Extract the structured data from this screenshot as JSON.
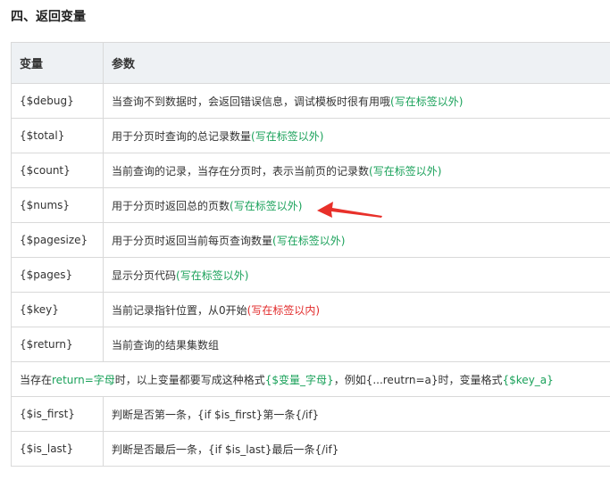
{
  "section_title": "四、返回变量",
  "table": {
    "headers": [
      "变量",
      "参数"
    ],
    "rows": [
      {
        "var": "{$debug}",
        "desc": "当查询不到数据时，会返回错误信息，调试模板时很有用哦",
        "note": "(写在标签以外)",
        "note_color": "#1aa15a"
      },
      {
        "var": "{$total}",
        "desc": "用于分页时查询的总记录数量",
        "note": "(写在标签以外)",
        "note_color": "#1aa15a"
      },
      {
        "var": "{$count}",
        "desc": "当前查询的记录，当存在分页时，表示当前页的记录数",
        "note": "(写在标签以外)",
        "note_color": "#1aa15a"
      },
      {
        "var": "{$nums}",
        "desc": "用于分页时返回总的页数",
        "note": "(写在标签以外)",
        "note_color": "#1aa15a"
      },
      {
        "var": "{$pagesize}",
        "desc": "用于分页时返回当前每页查询数量",
        "note": "(写在标签以外)",
        "note_color": "#1aa15a"
      },
      {
        "var": "{$pages}",
        "desc": "显示分页代码",
        "note": "(写在标签以外)",
        "note_color": "#1aa15a"
      },
      {
        "var": "{$key}",
        "desc": "当前记录指针位置，从0开始",
        "note": "(写在标签以内)",
        "note_color": "#e22a2a"
      },
      {
        "var": "{$return}",
        "desc": "当前查询的结果集数组",
        "note": "",
        "note_color": "#1aa15a"
      }
    ],
    "full_row": {
      "p1": "当存在",
      "g1": "return=字母",
      "p2": "时，以上变量都要写成这种格式",
      "g2": "{$变量_字母}",
      "p3": "，例如{...reutrn=a}时，变量格式",
      "g3": "{$key_a}"
    },
    "rows2": [
      {
        "var": "{$is_first}",
        "desc": "判断是否第一条，{if $is_first}第一条{/if}"
      },
      {
        "var": "{$is_last}",
        "desc": "判断是否最后一条，{if $is_last}最后一条{/if}"
      }
    ]
  },
  "colors": {
    "green": "#1aa15a",
    "red": "#e22a2a",
    "header_bg": "#eef1f4",
    "border": "#d9d9d9"
  }
}
